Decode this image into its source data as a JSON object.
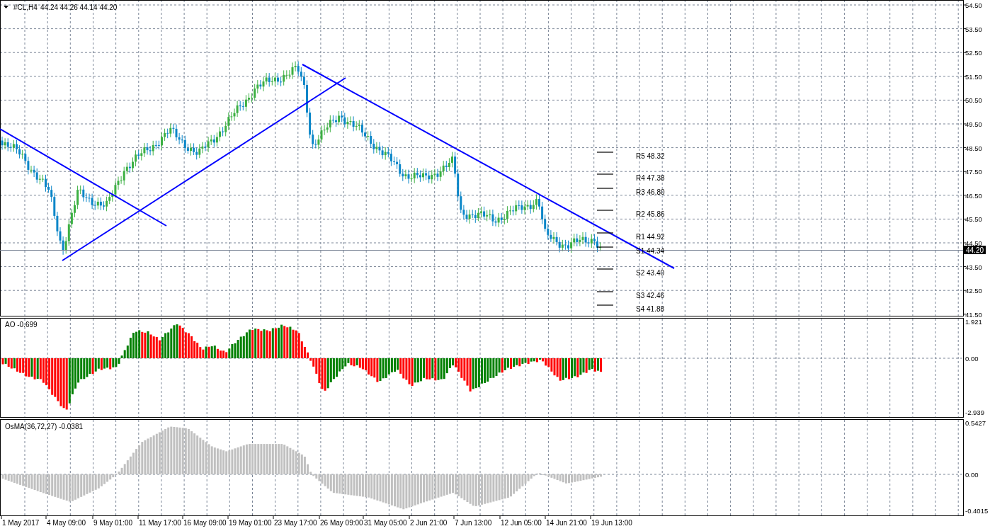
{
  "chart": {
    "symbol": "#CL,H4",
    "ohlc": "44.24 44.26 44.14 44.20"
  },
  "price_axis": [
    "54.50",
    "53.50",
    "52.50",
    "51.50",
    "50.50",
    "49.50",
    "48.50",
    "47.50",
    "46.50",
    "45.50",
    "44.50",
    "43.50",
    "42.50",
    "41.50"
  ],
  "current_price": "44.20",
  "pivot_levels": [
    {
      "label": "R5 48.32"
    },
    {
      "label": "R4 47.38"
    },
    {
      "label": "R3 46.80"
    },
    {
      "label": "R2 45.86"
    },
    {
      "label": "R1 44.92"
    },
    {
      "label": "S1 44.34"
    },
    {
      "label": "S2 43.40"
    },
    {
      "label": "S3 42.46"
    },
    {
      "label": "S4 41.88"
    }
  ],
  "indicators": [
    {
      "kind": "ao",
      "label": "AO -0.699",
      "axis": [
        "1.921",
        "0.00",
        "-2.939"
      ]
    },
    {
      "kind": "osma",
      "label": "OsMA(36,72,27) -0.0381",
      "axis": [
        "0.5427",
        "0.00",
        "-0.4015"
      ]
    }
  ],
  "time_axis": [
    "1 May 2017",
    "4 May 09:00",
    "9 May 01:00",
    "11 May 17:00",
    "16 May 09:00",
    "19 May 01:00",
    "23 May 17:00",
    "26 May 09:00",
    "31 May 05:00",
    "2 Jun 21:00",
    "7 Jun 13:00",
    "12 Jun 05:00",
    "14 Jun 21:00",
    "19 Jun 13:00"
  ]
}
